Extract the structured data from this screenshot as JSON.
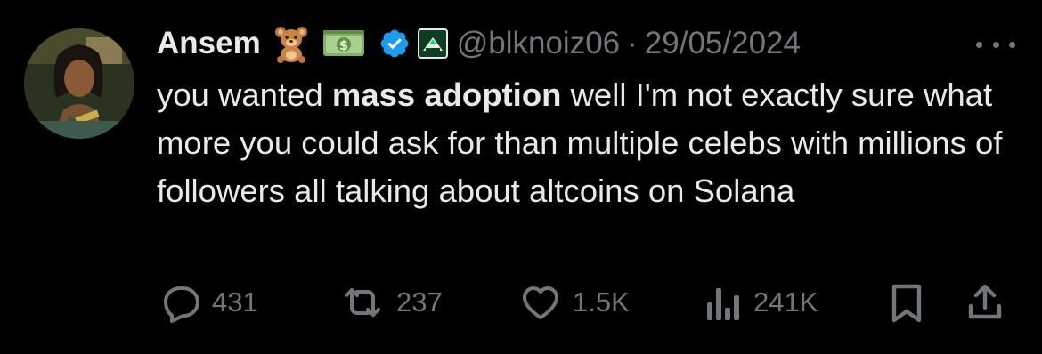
{
  "tweet": {
    "author_name": "Ansem",
    "emojis": [
      "teddy-bear-emoji",
      "dollar-banknote-emoji"
    ],
    "handle": "@blknoiz06",
    "separator": "·",
    "date": "29/05/2024",
    "text_before": "you wanted ",
    "text_bold": "mass adoption",
    "text_after": " well I'm not exactly sure what more you could ask for than multiple celebs with millions of followers all talking about altcoins on Solana"
  },
  "actions": {
    "replies": "431",
    "reposts": "237",
    "likes": "1.5K",
    "views": "241K"
  },
  "colors": {
    "background": "#000000",
    "text": "#e7e9ea",
    "muted": "#71767b",
    "verified": "#1d9bf0",
    "affiliate_bg": "#0f3d22"
  },
  "icons": [
    "verified-badge-icon",
    "affiliate-badge-icon",
    "more-icon",
    "reply-icon",
    "repost-icon",
    "like-icon",
    "views-icon",
    "bookmark-icon",
    "share-icon"
  ]
}
